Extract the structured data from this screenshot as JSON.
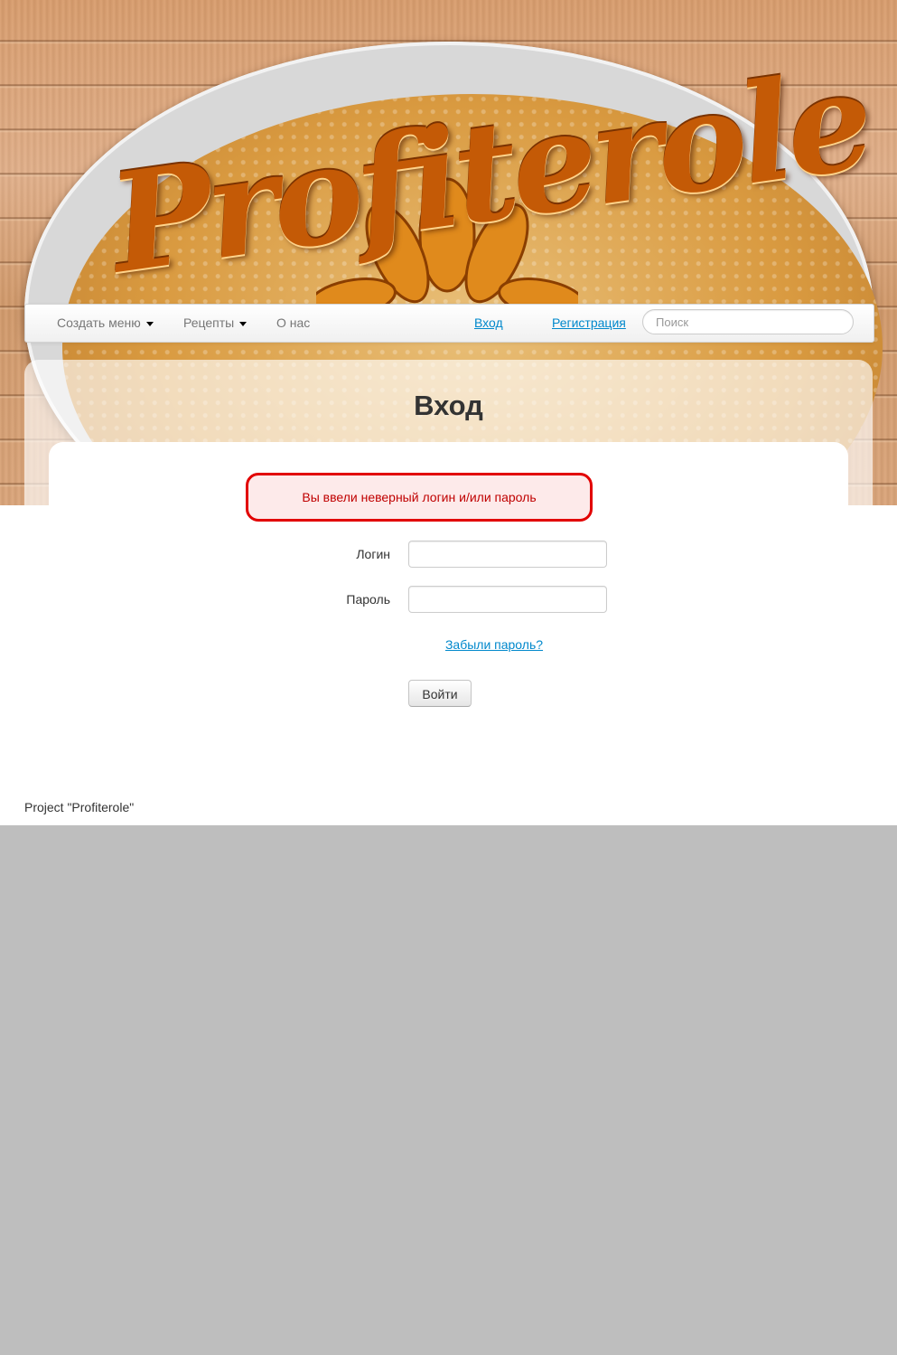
{
  "header": {
    "logo_text": "Profiterole"
  },
  "navbar": {
    "menu_create": "Создать меню",
    "menu_recipes": "Рецепты",
    "menu_about": "О нас",
    "login_link": "Вход",
    "register_link": "Регистрация",
    "search_placeholder": "Поиск"
  },
  "main": {
    "title": "Вход",
    "error_message": "Вы ввели неверный логин и/или пароль",
    "login_label": "Логин",
    "login_value": "",
    "password_label": "Пароль",
    "password_value": "",
    "forgot_link": "Забыли пароль?",
    "submit_label": "Войти"
  },
  "footer": {
    "text": "Project \"Profiterole\""
  },
  "colors": {
    "link": "#0088cc",
    "error_border": "#e20000",
    "error_text": "#c00000",
    "page_background": "#bebebe"
  }
}
